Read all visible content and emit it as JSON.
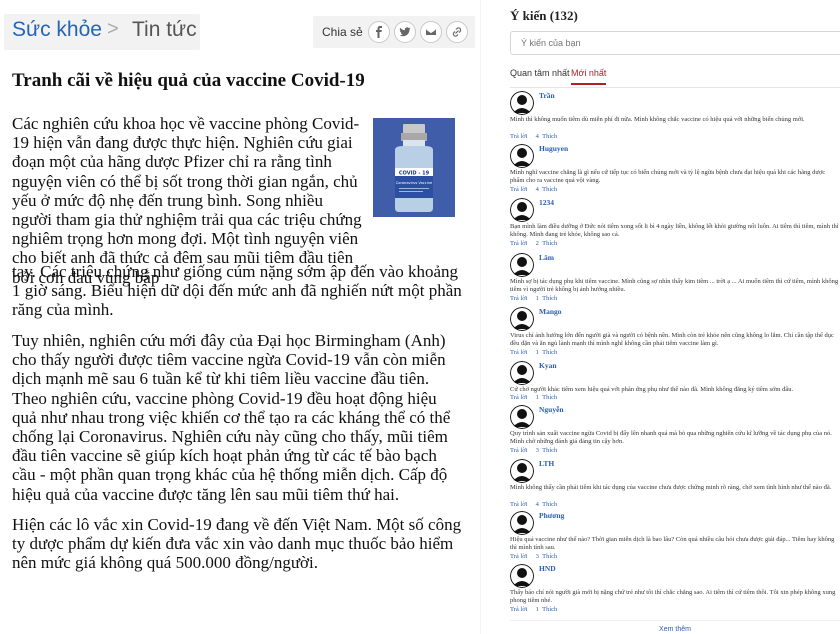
{
  "article": {
    "category": "Sức khỏe",
    "separator": ">",
    "subcategory": "Tin tức",
    "share_label": "Chia sẻ",
    "share_icons": [
      "facebook-icon",
      "twitter-icon",
      "mail-icon",
      "link-icon"
    ],
    "title": "Tranh cãi về hiệu quả của vaccine Covid-19",
    "p1_a": "Các nghiên cứu khoa học về vaccine phòng Covid-19 hiện vẫn đang được thực hiện. Nghiên cứu giai đoạn một của hãng dược Pfizer chỉ ra rằng tình nguyện viên có thể bị sốt trong thời gian ngắn, chủ yếu ở mức độ nhẹ đến trung bình. Song nhiều người tham gia thử nghiệm trải qua các triệu chứng nghiêm trọng hơn mong đợi. Một tình nguyện viên cho biết anh đã thức cả đêm sau mũi tiêm đầu tiên bởi cơn đau vùng bắp",
    "p1_b": "tay. Các triệu chứng như giống cúm nặng sớm ập đến vào khoảng 1 giờ sáng. Biểu hiện dữ dội đến mức anh đã nghiến nứt một phần răng của mình.",
    "p2": "Tuy nhiên, nghiên cứu mới đây của Đại học Birmingham (Anh) cho thấy người được tiêm vaccine ngừa Covid-19 vẫn còn miễn dịch mạnh mẽ sau 6 tuần kể từ khi tiêm liều vaccine đầu tiên. Theo nghiên cứu, vaccine phòng Covid-19 đều hoạt động hiệu quả như nhau trong việc khiến cơ thể tạo ra các kháng thể có thể chống lại Coronavirus. Nghiên cứu này cũng cho thấy, mũi tiêm đầu tiên vaccine sẽ giúp kích hoạt phản ứng từ các tế bào bạch cầu - một phần quan trọng khác của hệ thống miễn dịch. Cấp độ hiệu quả của vaccine được tăng lên sau mũi tiêm thứ hai.",
    "p3": "Hiện các lô vắc xin Covid-19 đang về đến Việt Nam. Một số công ty dược phẩm dự kiến đưa vắc xin vào danh mục thuốc bảo hiểm nên mức giá không quá 500.000 đồng/người.",
    "image_label": "COVID - 19",
    "image_text": "Coronavirus Vaccine"
  },
  "comments": {
    "header": "Ý kiến (132)",
    "placeholder": "Ý kiến của bạn",
    "tabs": [
      "Quan tâm nhất",
      "Mới nhất"
    ],
    "reply_label": "Trả lời",
    "like_label": "Thích",
    "more": "Xem thêm",
    "items": [
      {
        "name": "Trần",
        "text": "Mình thì không muốn tiêm dù miễn phí đi nữa. Mình không chắc vaccine có hiệu quả với những biến chủng mới.",
        "likes": "4"
      },
      {
        "name": "Huguyen",
        "text": "Mình nghĩ vaccine chẳng là gì nếu cứ tiếp tục có biến chủng mới và tỷ lệ ngừa bệnh chưa đạt hiệu quả khi các hãng dược phẩm cho ra vaccine quá vội vàng.",
        "likes": "4"
      },
      {
        "name": "1234",
        "text": "Bạn mình làm điều dưỡng ở Đức nói tiêm xong sốt li bì 4 ngày liền, không lết khỏi giường nổi luôn. Ai tiêm thì tiêm, mình thì không. Mình đang trẻ khỏe, không sao cả.",
        "likes": "2"
      },
      {
        "name": "Lâm",
        "text": "Mình sợ bị tác dụng phụ khi tiêm vaccine. Mình cũng sợ nhìn thấy kim tiêm ... trời ạ ... Ai muốn tiêm thì cứ tiêm, mình không tiêm vì người trẻ không bị ảnh hưởng nhiều.",
        "likes": "1"
      },
      {
        "name": "Mango",
        "text": "Virus chỉ ảnh hưởng lớn đến người già và người có bệnh nền. Mình còn trẻ khỏe nên cũng không lo lắm. Chỉ cần tập thể dục đều đặn và ăn ngủ lành mạnh thì mình nghĩ không cần phải tiêm vaccine làm gì.",
        "likes": "1"
      },
      {
        "name": "Kyan",
        "text": "Cứ chờ người khác tiêm xem hiệu quả với phản ứng phụ như thế nào đã. Mình không đăng ký tiêm sớm đâu.",
        "likes": "1"
      },
      {
        "name": "Nguyễn",
        "text": "Quy trình sản xuất vaccine ngừa Covid bị đẩy lên nhanh quá mà bỏ qua những nghiên cứu kĩ lưỡng về tác dụng phụ của nó. Mình chờ những đánh giá đáng tin cậy hơn.",
        "likes": "3"
      },
      {
        "name": "LTH",
        "text": "Mình không thấy cần phải tiêm khi tác dụng của vaccine chưa được chứng minh rõ ràng, chờ xem tình hình như thế nào đã.",
        "likes": "4"
      },
      {
        "name": "Phương",
        "text": "Hiệu quả vaccine như thế nào? Thời gian miễn dịch là bao lâu? Còn quá nhiều câu hỏi chưa được giải đáp... Tiêm hay không thì mình tính sau.",
        "likes": "3"
      },
      {
        "name": "HND",
        "text": "Thấy báo chí nói người già mới bị nặng chứ trẻ như tôi thì chắc chẳng sao. Ai tiêm thì cứ tiêm thôi. Tôi xin phép không xung phong tiêm nhé.",
        "likes": "1"
      }
    ]
  }
}
